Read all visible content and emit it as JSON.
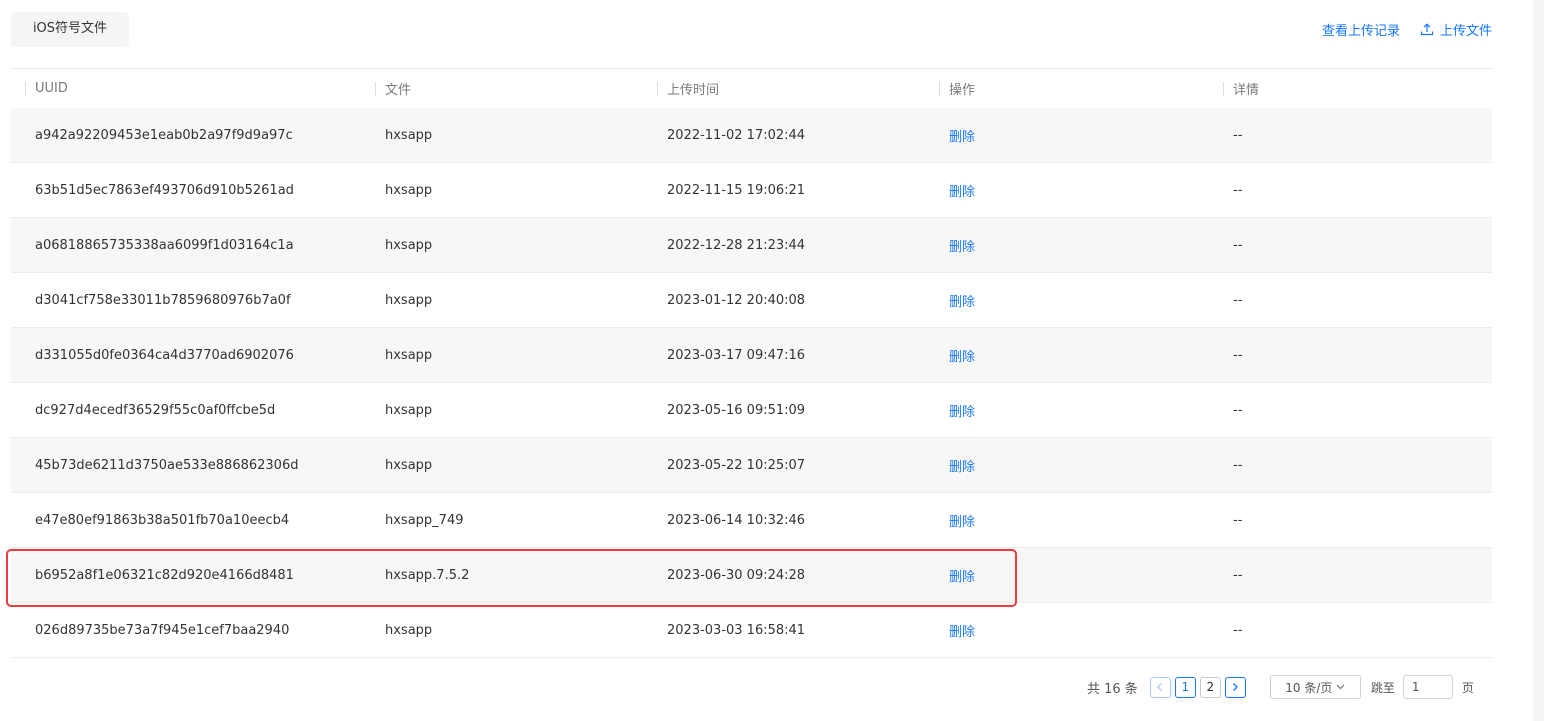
{
  "header": {
    "tab_label": "iOS符号文件",
    "view_upload_records": "查看上传记录",
    "upload_file": "上传文件",
    "upload_icon": "upload-icon"
  },
  "table": {
    "columns": [
      "UUID",
      "文件",
      "上传时间",
      "操作",
      "详情"
    ],
    "rows": [
      {
        "uuid": "a942a92209453e1eab0b2a97f9d9a97c",
        "file": "hxsapp",
        "time": "2022-11-02 17:02:44",
        "action": "删除",
        "detail": "--"
      },
      {
        "uuid": "63b51d5ec7863ef493706d910b5261ad",
        "file": "hxsapp",
        "time": "2022-11-15 19:06:21",
        "action": "删除",
        "detail": "--"
      },
      {
        "uuid": "a06818865735338aa6099f1d03164c1a",
        "file": "hxsapp",
        "time": "2022-12-28 21:23:44",
        "action": "删除",
        "detail": "--"
      },
      {
        "uuid": "d3041cf758e33011b7859680976b7a0f",
        "file": "hxsapp",
        "time": "2023-01-12 20:40:08",
        "action": "删除",
        "detail": "--"
      },
      {
        "uuid": "d331055d0fe0364ca4d3770ad6902076",
        "file": "hxsapp",
        "time": "2023-03-17 09:47:16",
        "action": "删除",
        "detail": "--"
      },
      {
        "uuid": "dc927d4ecedf36529f55c0af0ffcbe5d",
        "file": "hxsapp",
        "time": "2023-05-16 09:51:09",
        "action": "删除",
        "detail": "--"
      },
      {
        "uuid": "45b73de6211d3750ae533e886862306d",
        "file": "hxsapp",
        "time": "2023-05-22 10:25:07",
        "action": "删除",
        "detail": "--"
      },
      {
        "uuid": "e47e80ef91863b38a501fb70a10eecb4",
        "file": "hxsapp_749",
        "time": "2023-06-14 10:32:46",
        "action": "删除",
        "detail": "--"
      },
      {
        "uuid": "b6952a8f1e06321c82d920e4166d8481",
        "file": "hxsapp.7.5.2",
        "time": "2023-06-30 09:24:28",
        "action": "删除",
        "detail": "--"
      },
      {
        "uuid": "026d89735be73a7f945e1cef7baa2940",
        "file": "hxsapp",
        "time": "2023-03-03 16:58:41",
        "action": "删除",
        "detail": "--"
      }
    ],
    "highlight_color": "#ee3b3b"
  },
  "pagination": {
    "total_text": "共 16 条",
    "prev_icon": "chevron-left-icon",
    "next_icon": "chevron-right-icon",
    "pages": [
      "1",
      "2"
    ],
    "current_page": "1",
    "page_size": "10 条/页",
    "jump_label": "跳至",
    "jump_value": "1",
    "page_suffix": "页"
  },
  "colors": {
    "accent": "#1677ff",
    "stripe": "#f7f7f7"
  }
}
